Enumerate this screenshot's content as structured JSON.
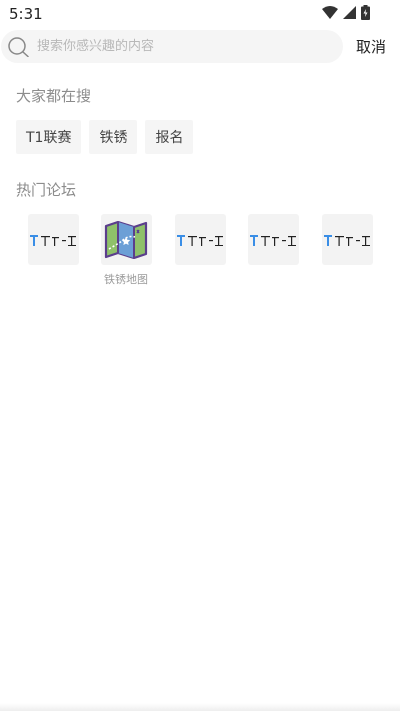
{
  "status_bar": {
    "time": "5:31",
    "icons": [
      "wifi-icon",
      "cellular-signal-icon",
      "battery-icon"
    ]
  },
  "search": {
    "placeholder": "搜索你感兴趣的内容",
    "value": "",
    "cancel_label": "取消"
  },
  "hot_search": {
    "title": "大家都在搜",
    "tags": [
      "T1联赛",
      "铁锈",
      "报名"
    ]
  },
  "hot_forums": {
    "title": "热门论坛",
    "items": [
      {
        "name": "",
        "icon": "forum-logo-icon"
      },
      {
        "name": "铁锈地图",
        "icon": "map-icon"
      },
      {
        "name": "",
        "icon": "forum-logo-icon"
      },
      {
        "name": "",
        "icon": "forum-logo-icon"
      },
      {
        "name": "",
        "icon": "forum-logo-icon"
      }
    ]
  },
  "colors": {
    "accent_blue": "#3a8ee6",
    "map_green": "#8fc16a",
    "map_purple": "#5b3e8c"
  }
}
